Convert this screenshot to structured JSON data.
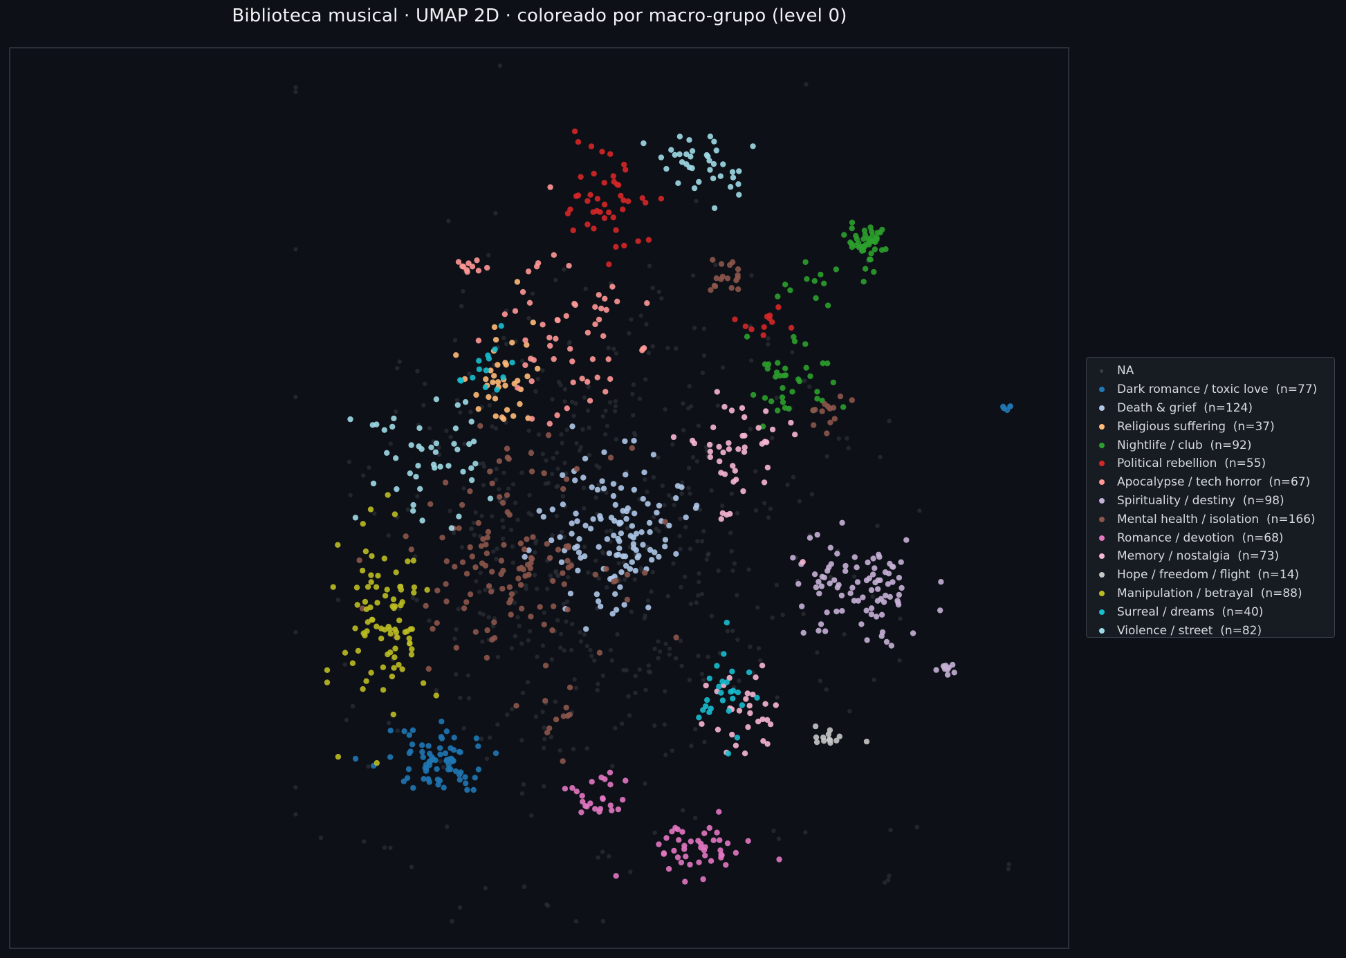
{
  "chart_data": {
    "type": "scatter",
    "title": "Biblioteca musical · UMAP 2D · coloreado por macro-grupo (level 0)",
    "xlabel": "",
    "ylabel": "",
    "xlim": [
      0,
      100
    ],
    "ylim": [
      0,
      100
    ],
    "grid": false,
    "legend_position": "right",
    "background": "#0d1017",
    "plot_border_color": "#343a44",
    "na_color": "#2b2f36",
    "legend": [
      {
        "label": "NA",
        "color": "#3a3e45"
      },
      {
        "label": "Dark romance / toxic love  (n=77)",
        "color": "#1f77b4"
      },
      {
        "label": "Death & grief  (n=124)",
        "color": "#aec7e8"
      },
      {
        "label": "Religious suffering  (n=37)",
        "color": "#ffbb78"
      },
      {
        "label": "Nightlife / club  (n=92)",
        "color": "#2ca02c"
      },
      {
        "label": "Political rebellion  (n=55)",
        "color": "#d62728"
      },
      {
        "label": "Apocalypse / tech horror  (n=67)",
        "color": "#ff9896"
      },
      {
        "label": "Spirituality / destiny  (n=98)",
        "color": "#c5b0d5"
      },
      {
        "label": "Mental health / isolation  (n=166)",
        "color": "#8c564b"
      },
      {
        "label": "Romance / devotion  (n=68)",
        "color": "#e377c2"
      },
      {
        "label": "Memory / nostalgia  (n=73)",
        "color": "#f7b6d2"
      },
      {
        "label": "Hope / freedom / flight  (n=14)",
        "color": "#c7c7c7"
      },
      {
        "label": "Manipulation / betrayal  (n=88)",
        "color": "#bcbd22"
      },
      {
        "label": "Surreal / dreams  (n=40)",
        "color": "#17becf"
      },
      {
        "label": "Violence / street  (n=82)",
        "color": "#9edae5"
      }
    ],
    "series": [
      {
        "name": "Dark romance / toxic love  (n=77)",
        "color": "#1f77b4",
        "count": 77,
        "clusters": [
          {
            "cx": 40.5,
            "cy": 21,
            "sx": 2.4,
            "sy": 1.8,
            "w": 0.92
          },
          {
            "cx": 94.1,
            "cy": 60.1,
            "sx": 0.3,
            "sy": 0.3,
            "w": 0.08
          }
        ]
      },
      {
        "name": "Death & grief  (n=124)",
        "color": "#aec7e8",
        "count": 124,
        "clusters": [
          {
            "cx": 57.5,
            "cy": 46,
            "sx": 3.2,
            "sy": 4.5,
            "w": 1
          }
        ]
      },
      {
        "name": "Religious suffering  (n=37)",
        "color": "#ffbb78",
        "count": 37,
        "clusters": [
          {
            "cx": 46.3,
            "cy": 63.8,
            "sx": 1.6,
            "sy": 2.8,
            "w": 1
          }
        ]
      },
      {
        "name": "Nightlife / club  (n=92)",
        "color": "#2ca02c",
        "count": 92,
        "clusters": [
          {
            "cx": 80.8,
            "cy": 78.5,
            "sx": 1.0,
            "sy": 1.0,
            "w": 0.45
          },
          {
            "cx": 73.5,
            "cy": 62.5,
            "sx": 2.0,
            "sy": 2.5,
            "w": 0.4
          },
          {
            "cx": 76,
            "cy": 74,
            "sx": 2.5,
            "sy": 1.0,
            "w": 0.15
          }
        ]
      },
      {
        "name": "Political rebellion  (n=55)",
        "color": "#d62728",
        "count": 55,
        "clusters": [
          {
            "cx": 56.5,
            "cy": 83,
            "sx": 2.5,
            "sy": 3.5,
            "w": 0.8
          },
          {
            "cx": 71,
            "cy": 69.5,
            "sx": 1.2,
            "sy": 0.8,
            "w": 0.2
          }
        ]
      },
      {
        "name": "Apocalypse / tech horror  (n=67)",
        "color": "#ff9896",
        "count": 67,
        "clusters": [
          {
            "cx": 52.5,
            "cy": 68,
            "sx": 3.5,
            "sy": 5.0,
            "w": 0.85
          },
          {
            "cx": 43.8,
            "cy": 75.8,
            "sx": 0.8,
            "sy": 0.5,
            "w": 0.15
          }
        ]
      },
      {
        "name": "Spirituality / destiny  (n=98)",
        "color": "#c5b0d5",
        "count": 98,
        "clusters": [
          {
            "cx": 80,
            "cy": 39.5,
            "sx": 3.5,
            "sy": 3.0,
            "w": 0.9
          },
          {
            "cx": 88.5,
            "cy": 31,
            "sx": 0.4,
            "sy": 0.3,
            "w": 0.1
          }
        ]
      },
      {
        "name": "Mental health / isolation  (n=166)",
        "color": "#8c564b",
        "count": 166,
        "clusters": [
          {
            "cx": 47,
            "cy": 44,
            "sx": 5.0,
            "sy": 5.5,
            "w": 0.75
          },
          {
            "cx": 68,
            "cy": 74.5,
            "sx": 1.0,
            "sy": 1.0,
            "w": 0.1
          },
          {
            "cx": 77.2,
            "cy": 59.5,
            "sx": 1.0,
            "sy": 1.0,
            "w": 0.08
          },
          {
            "cx": 51.5,
            "cy": 25.5,
            "sx": 1.5,
            "sy": 2.0,
            "w": 0.07
          }
        ]
      },
      {
        "name": "Romance / devotion  (n=68)",
        "color": "#e377c2",
        "count": 68,
        "clusters": [
          {
            "cx": 64.5,
            "cy": 11,
            "sx": 3.0,
            "sy": 1.5,
            "w": 0.65
          },
          {
            "cx": 55.5,
            "cy": 16.5,
            "sx": 1.5,
            "sy": 1.5,
            "w": 0.35
          }
        ]
      },
      {
        "name": "Memory / nostalgia  (n=73)",
        "color": "#f7b6d2",
        "count": 73,
        "clusters": [
          {
            "cx": 68.5,
            "cy": 55,
            "sx": 2.5,
            "sy": 4.0,
            "w": 0.6
          },
          {
            "cx": 69,
            "cy": 25.5,
            "sx": 2.0,
            "sy": 2.5,
            "w": 0.4
          }
        ]
      },
      {
        "name": "Hope / freedom / flight  (n=14)",
        "color": "#c7c7c7",
        "count": 14,
        "clusters": [
          {
            "cx": 77.5,
            "cy": 23.5,
            "sx": 0.8,
            "sy": 0.6,
            "w": 1
          }
        ]
      },
      {
        "name": "Manipulation / betrayal  (n=88)",
        "color": "#bcbd22",
        "count": 88,
        "clusters": [
          {
            "cx": 35.5,
            "cy": 36,
            "sx": 2.0,
            "sy": 5.5,
            "w": 1
          }
        ]
      },
      {
        "name": "Surreal / dreams  (n=40)",
        "color": "#17becf",
        "count": 40,
        "clusters": [
          {
            "cx": 67.5,
            "cy": 28.5,
            "sx": 1.2,
            "sy": 2.8,
            "w": 0.65
          },
          {
            "cx": 45,
            "cy": 64,
            "sx": 1.3,
            "sy": 2.3,
            "w": 0.35
          }
        ]
      },
      {
        "name": "Violence / street  (n=82)",
        "color": "#9edae5",
        "count": 82,
        "clusters": [
          {
            "cx": 65.5,
            "cy": 87,
            "sx": 2.5,
            "sy": 2.0,
            "w": 0.45
          },
          {
            "cx": 38.5,
            "cy": 54,
            "sx": 3.0,
            "sy": 3.5,
            "w": 0.55
          }
        ]
      }
    ],
    "na_clusters": [
      {
        "cx": 56,
        "cy": 45,
        "sx": 11.5,
        "sy": 15.5,
        "count": 560
      },
      {
        "cx": 4.6,
        "cy": 95.3,
        "sx": 0.3,
        "sy": 0.3,
        "count": 2
      },
      {
        "cx": 50.8,
        "cy": 4.7,
        "sx": 0.3,
        "sy": 0.3,
        "count": 2
      },
      {
        "cx": 82.5,
        "cy": 7.2,
        "sx": 0.4,
        "sy": 0.4,
        "count": 3
      },
      {
        "cx": 94.5,
        "cy": 9.0,
        "sx": 0.3,
        "sy": 0.3,
        "count": 2
      },
      {
        "cx": 35.5,
        "cy": 11.5,
        "sx": 0.3,
        "sy": 0.3,
        "count": 2
      }
    ]
  }
}
